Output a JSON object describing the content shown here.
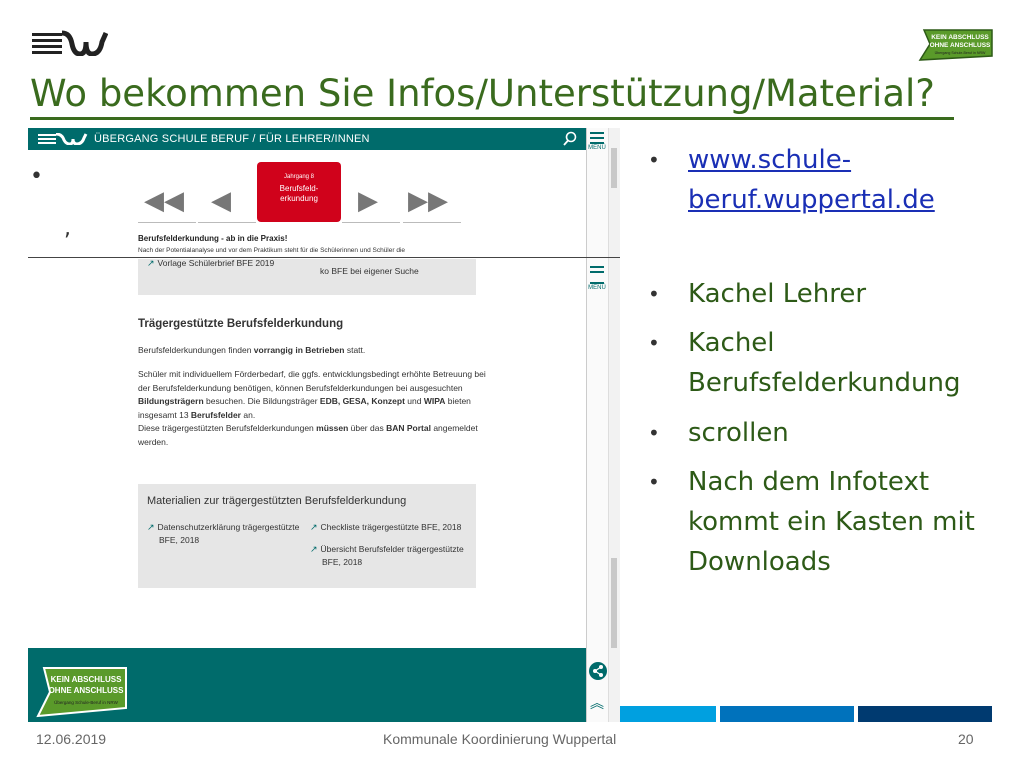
{
  "slide": {
    "title": "Wo bekommen Sie Infos/Unterstützung/Material?",
    "date": "12.06.2019",
    "footer_center": "Kommunale Koordinierung Wuppertal",
    "page_number": "20"
  },
  "logo_right": {
    "line1": "KEIN ABSCHLUSS",
    "line2": "OHNE ANSCHLUSS",
    "line3": "Übergang Schule-Beruf in NRW"
  },
  "screenshot": {
    "header_brand": "ÜBERGANG SCHULE BERUF / FÜR LEHRER/INNEN",
    "menu_label": "MENÜ",
    "tile": {
      "small": "Jahrgang 8",
      "line1": "Berufsfeld-",
      "line2": "erkundung"
    },
    "subheading": "Berufsfelderkundung - ab in die Praxis!",
    "subtext": "Nach der Potentialanalyse und vor dem Praktikum steht für die Schülerinnen und Schüler die",
    "top_box": {
      "item1": "Vorlage Schülerbrief BFE 2019",
      "item2": "ko BFE bei eigener Suche"
    },
    "section_title": "Trägergestützte Berufsfelderkundung",
    "para1": {
      "a": "Berufsfelderkundungen finden ",
      "b": "vorrangig in Betrieben",
      "c": " statt."
    },
    "para2": {
      "l1": "Schüler mit individuellem Förderbedarf, die ggfs. entwicklungsbedingt erhöhte Betreuung bei",
      "l2": "der Berufsfelderkundung benötigen, können Berufsfelderkundungen bei ausgesuchten",
      "l3a": "Bildungsträgern",
      "l3b": " besuchen. Die Bildungsträger ",
      "l3c": "EDB, GESA, Konzept",
      "l3d": " und ",
      "l3e": "WIPA",
      "l3f": " bieten",
      "l4a": "insgesamt 13 ",
      "l4b": "Berufsfelder",
      "l4c": " an.",
      "l5a": "Diese trägergestützten Berufsfelderkundungen ",
      "l5b": "müssen",
      "l5c": " über das ",
      "l5d": "BAN Portal",
      "l5e": " angemeldet",
      "l6": "werden."
    },
    "materials": {
      "title": "Materialien zur trägergestützten Berufsfelderkundung",
      "left1": "Datenschutzerklärung trägergestützte",
      "left2": "BFE, 2018",
      "right1": "Checkliste trägergestützte BFE, 2018",
      "right2a": "Übersicht Berufsfelder trägergestützte",
      "right2b": "BFE, 2018"
    },
    "footer_logo": {
      "line1": "KEIN ABSCHLUSS",
      "line2": "OHNE ANSCHLUSS",
      "line3": "Übergang Schule-Beruf in NRW"
    }
  },
  "bullets": {
    "link1": "www.schule-",
    "link2": "beruf.wuppertal.de",
    "b2": "Kachel Lehrer",
    "b3a": "Kachel",
    "b3b": "Berufsfelderkundung",
    "b4": "scrollen",
    "b5a": "Nach dem Infotext",
    "b5b": "kommt ein Kasten mit",
    "b5c": "Downloads"
  },
  "colors": {
    "title_green": "#3a6b1e",
    "teal": "#006b6b",
    "tile_red": "#d0021b",
    "link_blue": "#1a2fb5",
    "bar_blue_1": "#00a0e0",
    "bar_blue_2": "#0072bc",
    "bar_blue_3": "#003a70"
  },
  "icons": [
    "wuppertal-logo-icon",
    "kein-abschluss-logo-icon",
    "search-icon",
    "menu-icon",
    "share-icon",
    "chevron-up-icon",
    "rewind-icon",
    "previous-icon",
    "next-icon",
    "fast-forward-icon",
    "external-arrow-icon"
  ]
}
